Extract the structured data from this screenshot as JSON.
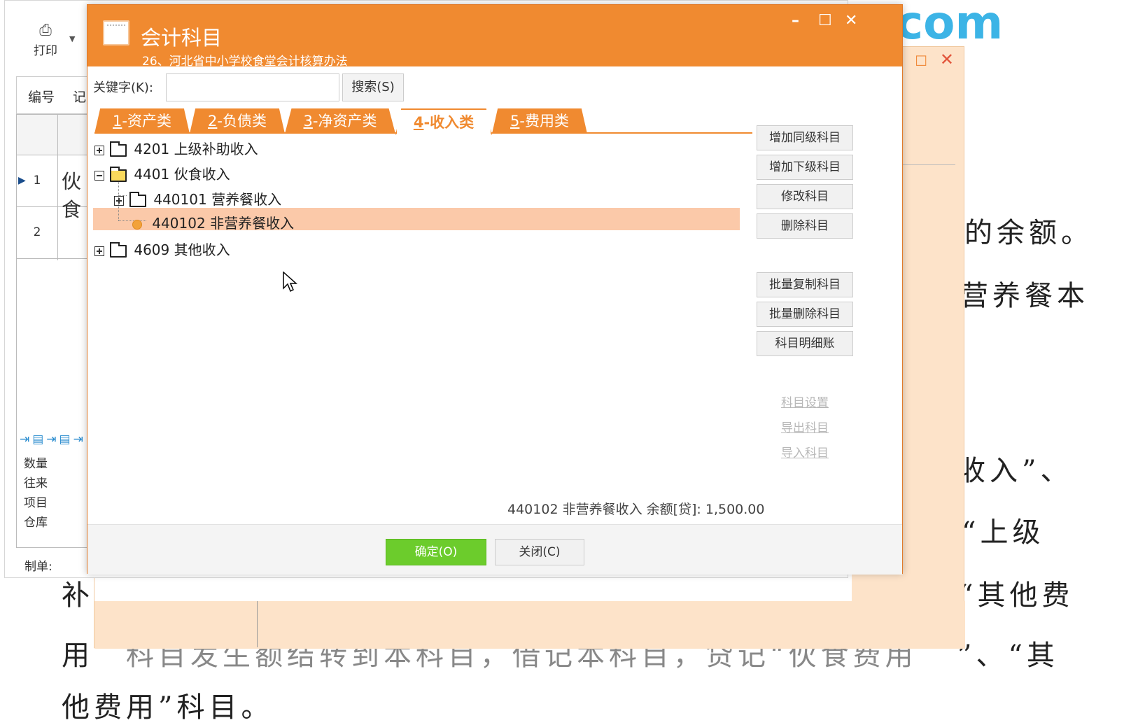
{
  "background_doc": {
    "brand": "com",
    "line1": "的余额。",
    "line2": "营养餐本",
    "line3": "收入”、",
    "line4": "“上级",
    "line5_left": "补",
    "line5_right": "“其他费",
    "line6_left": "用",
    "line6_mid": "科目发生额结转到本科目，借记本科目，贷记“伙食费用",
    "line6_right": "”、“其",
    "line7": "他费用”科目。"
  },
  "voucher_window": {
    "print_label": "打印",
    "number_label": "编号",
    "record_label": "记",
    "rows": [
      {
        "no": "1",
        "text": "伙食"
      },
      {
        "no": "2",
        "text": ""
      }
    ],
    "fields": [
      "数量",
      "往来",
      "项目",
      "仓库"
    ],
    "maker_label": "制单:"
  },
  "dialog": {
    "title": "会计科目",
    "subtitle": "26、河北省中小学校食堂会计核算办法",
    "window_buttons": {
      "minimize": "–",
      "maximize": "☐",
      "close": "✕"
    },
    "keyword_label": "关键字(K):",
    "keyword_value": "",
    "search_button": "搜索(S)",
    "tabs": [
      {
        "prefix": "1",
        "label": "-资产类"
      },
      {
        "prefix": "2",
        "label": "-负债类"
      },
      {
        "prefix": "3",
        "label": "-净资产类"
      },
      {
        "prefix": "4",
        "label": "-收入类"
      },
      {
        "prefix": "5",
        "label": "-费用类"
      }
    ],
    "active_tab": 3,
    "tree": [
      {
        "code": "4201",
        "name": "上级补助收入",
        "expanded": false
      },
      {
        "code": "4401",
        "name": "伙食收入",
        "expanded": true
      },
      {
        "code": "440101",
        "name": "营养餐收入",
        "expanded": false
      },
      {
        "code": "440102",
        "name": "非营养餐收入",
        "selected": true
      },
      {
        "code": "4609",
        "name": "其他收入",
        "expanded": false
      }
    ],
    "side_buttons": [
      "增加同级科目",
      "增加下级科目",
      "修改科目",
      "删除科目",
      "批量复制科目",
      "批量删除科目",
      "科目明细账"
    ],
    "side_links": [
      "科目设置",
      "导出科目",
      "导入科目"
    ],
    "balance_text": "440102 非营养餐收入 余额[贷]: 1,500.00",
    "ok_button": "确定(O)",
    "close_button": "关闭(C)"
  },
  "colors": {
    "title_orange": "#f08a30",
    "selection": "#fbc9a9",
    "ok_green": "#6ccc2c",
    "brand_blue": "#3cb4e6"
  }
}
